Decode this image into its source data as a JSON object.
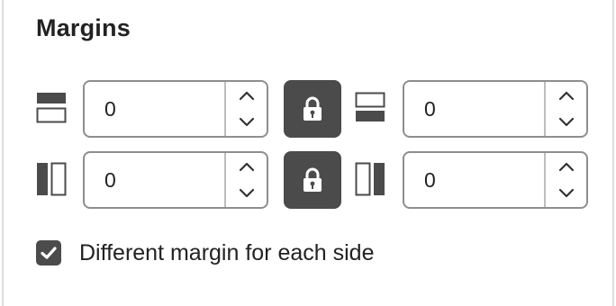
{
  "panel": {
    "title": "Margins"
  },
  "margins": {
    "top": {
      "value": "0",
      "icon": "margin-top-icon"
    },
    "bottom": {
      "value": "0",
      "icon": "margin-bottom-icon"
    },
    "left": {
      "value": "0",
      "icon": "margin-left-icon"
    },
    "right": {
      "value": "0",
      "icon": "margin-right-icon"
    }
  },
  "lock": {
    "icon": "lock-icon",
    "top_bottom_locked": true,
    "left_right_locked": true
  },
  "different_sides": {
    "label": "Different margin for each side",
    "checked": true
  },
  "colors": {
    "accent": "#4b4b4b",
    "border": "#8e8e8e",
    "text": "#222222"
  }
}
